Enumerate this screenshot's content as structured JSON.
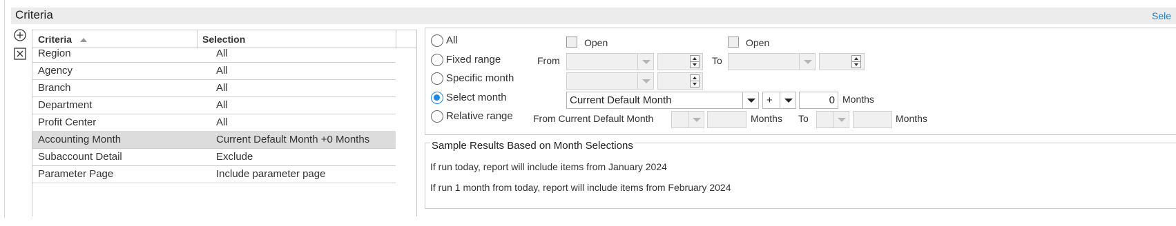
{
  "header": {
    "title": "Criteria",
    "right_link": "Sele"
  },
  "toolbar": {
    "add_icon": "plus-circle-icon",
    "remove_icon": "x-box-icon"
  },
  "grid": {
    "columns": {
      "criteria": "Criteria",
      "selection": "Selection"
    },
    "sort_icon": "sort-asc-icon",
    "rows": [
      {
        "criteria": "Region",
        "selection": "All"
      },
      {
        "criteria": "Agency",
        "selection": "All"
      },
      {
        "criteria": "Branch",
        "selection": "All"
      },
      {
        "criteria": "Department",
        "selection": "All"
      },
      {
        "criteria": "Profit Center",
        "selection": "All"
      },
      {
        "criteria": "Accounting Month",
        "selection": "Current Default Month +0 Months",
        "selected": true
      },
      {
        "criteria": "Subaccount Detail",
        "selection": "Exclude"
      },
      {
        "criteria": "Parameter Page",
        "selection": "Include parameter page"
      }
    ]
  },
  "options": {
    "all": "All",
    "fixed_range": "Fixed range",
    "specific_month": "Specific month",
    "select_month": "Select month",
    "relative_range": "Relative range",
    "selected": "select_month",
    "open_label_1": "Open",
    "open_label_2": "Open",
    "from_label": "From",
    "to_label": "To",
    "select_month_value": "Current Default Month",
    "sign_value": "+",
    "months_value": "0",
    "months_label": "Months",
    "relative_from_label": "From Current Default Month",
    "relative_months_label_1": "Months",
    "relative_to_label": "To",
    "relative_months_label_2": "Months"
  },
  "sample": {
    "legend": "Sample Results Based on Month Selections",
    "line1": "If run today, report will include items from January 2024",
    "line2": "If run 1 month from today, report will include items from February 2024"
  },
  "colors": {
    "accent": "#1e88e5",
    "selected_row": "#dcdcdc",
    "header_bg": "#ececec"
  }
}
